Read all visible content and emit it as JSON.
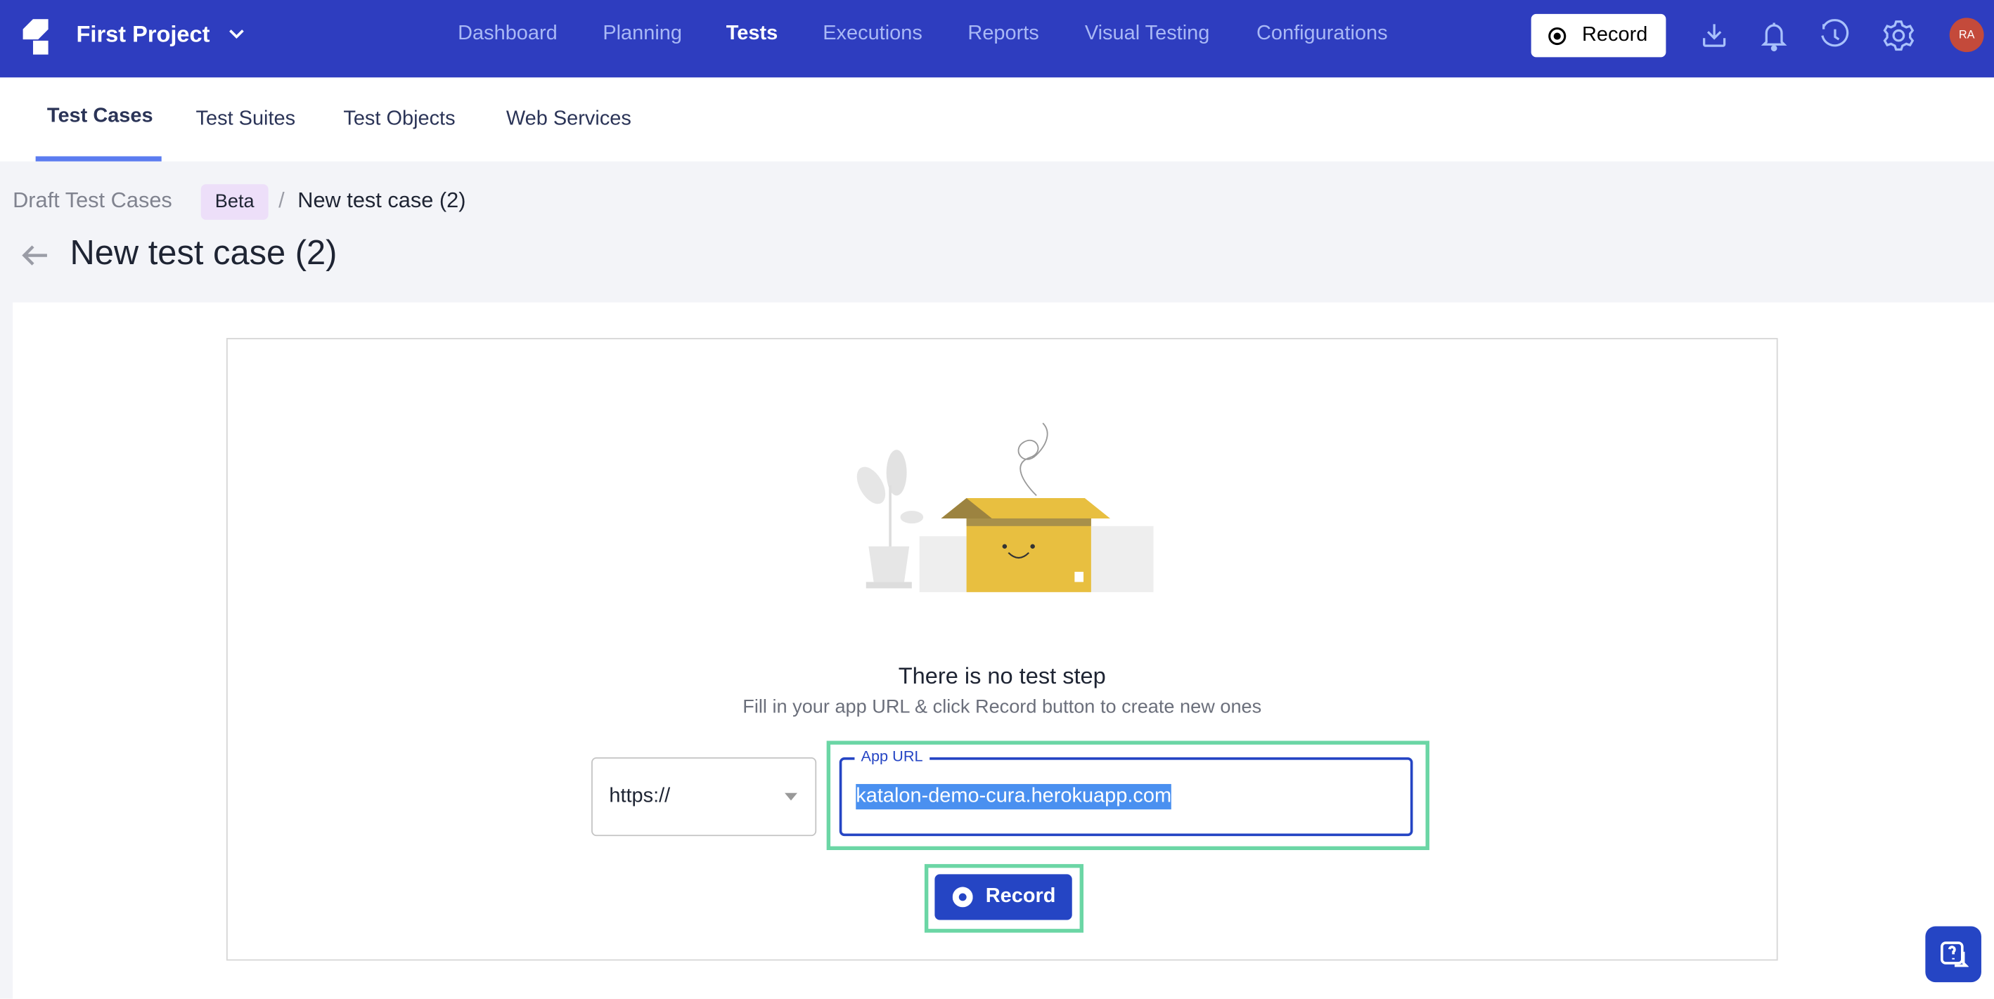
{
  "header": {
    "project": "First Project",
    "nav": [
      "Dashboard",
      "Planning",
      "Tests",
      "Executions",
      "Reports",
      "Visual Testing",
      "Configurations"
    ],
    "active_nav": "Tests",
    "record_label": "Record",
    "avatar_initials": "RA",
    "colors": {
      "bar": "#2e3dbf",
      "avatar": "#c44a3b"
    }
  },
  "subnav": {
    "tabs": [
      "Test Cases",
      "Test Suites",
      "Test Objects",
      "Web Services"
    ],
    "active": "Test Cases"
  },
  "breadcrumb": {
    "parent": "Draft Test Cases",
    "badge": "Beta",
    "separator": "/",
    "current": "New test case (2)"
  },
  "page_title": "New test case (2)",
  "empty_state": {
    "title": "There is no test step",
    "subtitle": "Fill in your app URL & click Record button to create new ones"
  },
  "form": {
    "protocol": "https://",
    "url_label": "App URL",
    "url_value": "katalon-demo-cura.herokuapp.com",
    "record_label": "Record"
  }
}
